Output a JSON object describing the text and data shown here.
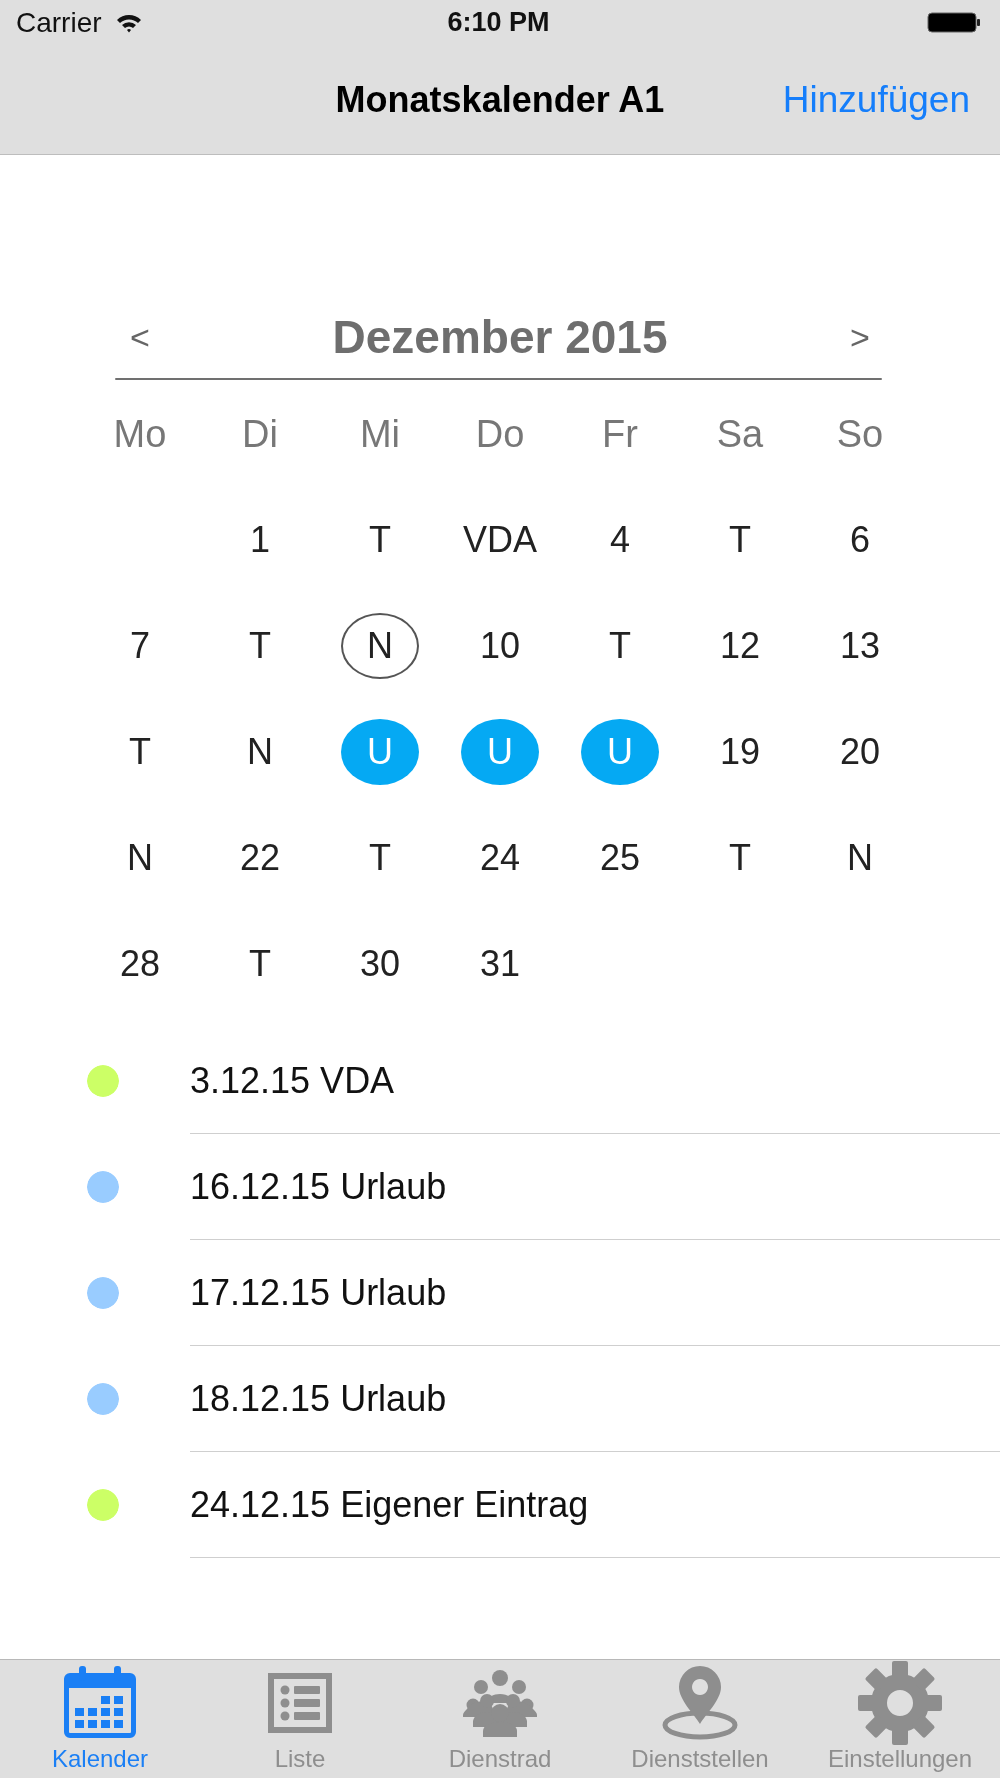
{
  "status_bar": {
    "carrier": "Carrier",
    "time": "6:10 PM"
  },
  "nav_bar": {
    "title": "Monatskalender A1",
    "action": "Hinzufügen"
  },
  "calendar": {
    "previous": "<",
    "month": "Dezember 2015",
    "next": ">",
    "weekdays": [
      "Mo",
      "Di",
      "Mi",
      "Do",
      "Fr",
      "Sa",
      "So"
    ],
    "weeks": [
      [
        {
          "kind": "blank"
        },
        {
          "kind": "plain",
          "label": "1",
          "selected": false
        },
        {
          "kind": "plain",
          "label": "T",
          "selected": false
        },
        {
          "kind": "plain",
          "label": "VDA",
          "selected": false
        },
        {
          "kind": "plain",
          "label": "4",
          "selected": false
        },
        {
          "kind": "plain",
          "label": "T",
          "selected": false
        },
        {
          "kind": "plain",
          "label": "6",
          "selected": false
        }
      ],
      [
        {
          "kind": "plain",
          "label": "7",
          "selected": false
        },
        {
          "kind": "plain",
          "label": "T",
          "selected": false
        },
        {
          "kind": "plain",
          "label": "N",
          "selected": true
        },
        {
          "kind": "plain",
          "label": "10",
          "selected": false
        },
        {
          "kind": "plain",
          "label": "T",
          "selected": false
        },
        {
          "kind": "plain",
          "label": "12",
          "selected": false
        },
        {
          "kind": "plain",
          "label": "13",
          "selected": false
        }
      ],
      [
        {
          "kind": "plain",
          "label": "T",
          "selected": false
        },
        {
          "kind": "plain",
          "label": "N",
          "selected": false
        },
        {
          "kind": "filled",
          "label": "U",
          "selected": false
        },
        {
          "kind": "filled",
          "label": "U",
          "selected": false
        },
        {
          "kind": "filled",
          "label": "U",
          "selected": false
        },
        {
          "kind": "plain",
          "label": "19",
          "selected": false
        },
        {
          "kind": "plain",
          "label": "20",
          "selected": false
        }
      ],
      [
        {
          "kind": "plain",
          "label": "N",
          "selected": false
        },
        {
          "kind": "plain",
          "label": "22",
          "selected": false
        },
        {
          "kind": "plain",
          "label": "T",
          "selected": false
        },
        {
          "kind": "plain",
          "label": "24",
          "selected": false
        },
        {
          "kind": "plain",
          "label": "25",
          "selected": false
        },
        {
          "kind": "plain",
          "label": "T",
          "selected": false
        },
        {
          "kind": "plain",
          "label": "N",
          "selected": false
        }
      ],
      [
        {
          "kind": "plain",
          "label": "28",
          "selected": false
        },
        {
          "kind": "plain",
          "label": "T",
          "selected": false
        },
        {
          "kind": "plain",
          "label": "30",
          "selected": false
        },
        {
          "kind": "plain",
          "label": "31",
          "selected": false
        }
      ]
    ]
  },
  "events": [
    {
      "label": "3.12.15 VDA",
      "color": "#ccff66"
    },
    {
      "label": "16.12.15 Urlaub",
      "color": "#99ccff"
    },
    {
      "label": "17.12.15 Urlaub",
      "color": "#99ccff"
    },
    {
      "label": "18.12.15 Urlaub",
      "color": "#99ccff"
    },
    {
      "label": "24.12.15 Eigener Eintrag",
      "color": "#ccff66"
    }
  ],
  "tab_bar": [
    {
      "label": "Kalender",
      "selected": true
    },
    {
      "label": "Liste",
      "selected": false
    },
    {
      "label": "Dienstrad",
      "selected": false
    },
    {
      "label": "Dienststellen",
      "selected": false
    },
    {
      "label": "Einstellungen",
      "selected": false
    }
  ]
}
